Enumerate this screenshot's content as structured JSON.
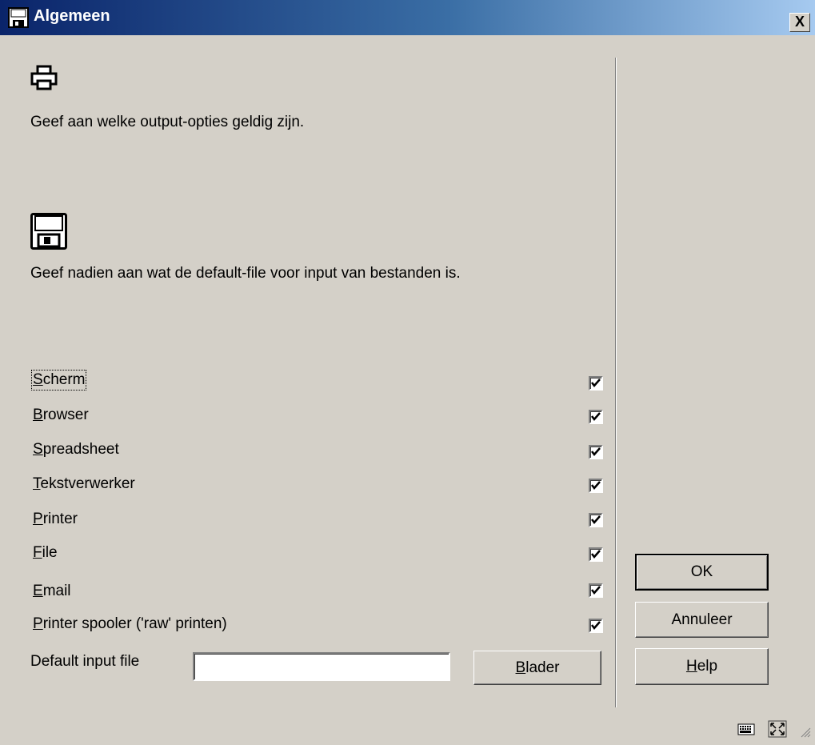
{
  "window": {
    "title": "Algemeen",
    "close_label": "X"
  },
  "intro": {
    "output_text": "Geef aan welke output-opties geldig zijn.",
    "input_text": "Geef nadien aan wat de default-file voor input van bestanden is."
  },
  "options": [
    {
      "accel": "S",
      "rest": "cherm",
      "checked": true
    },
    {
      "accel": "B",
      "rest": "rowser",
      "checked": true
    },
    {
      "accel": "S",
      "rest": "preadsheet",
      "checked": true
    },
    {
      "accel": "T",
      "rest": "ekstverwerker",
      "checked": true
    },
    {
      "accel": "P",
      "rest": "rinter",
      "checked": true
    },
    {
      "accel": "F",
      "rest": "ile",
      "checked": true
    },
    {
      "accel": "E",
      "rest": "mail",
      "checked": true
    },
    {
      "accel": "P",
      "rest": "rinter spooler ('raw' printen)",
      "checked": true
    }
  ],
  "default_input": {
    "label": "Default input file",
    "value": "",
    "browse_accel": "B",
    "browse_rest": "lader"
  },
  "buttons": {
    "ok": "OK",
    "cancel": "Annuleer",
    "help_accel": "H",
    "help_rest": "elp"
  },
  "icons": {
    "title": "floppy-disk-icon",
    "output": "printer-icon",
    "input": "floppy-disk-icon",
    "status_left": "keyboard-icon",
    "status_right": "maximize-icon"
  }
}
